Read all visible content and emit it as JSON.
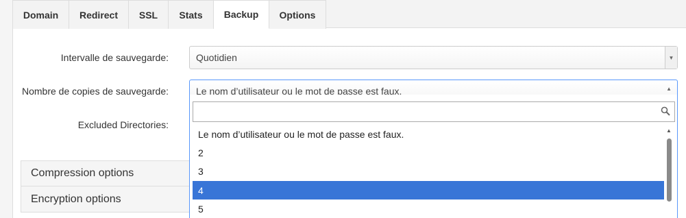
{
  "tabs": [
    {
      "label": "Domain"
    },
    {
      "label": "Redirect"
    },
    {
      "label": "SSL"
    },
    {
      "label": "Stats"
    },
    {
      "label": "Backup",
      "active": true
    },
    {
      "label": "Options"
    }
  ],
  "form": {
    "interval_label": "Intervalle de sauvegarde:",
    "interval_value": "Quotidien",
    "copies_label": "Nombre de copies de sauvegarde:",
    "copies_value": "Le nom d’utilisateur ou le mot de passe est faux.",
    "excluded_label": "Excluded Directories:"
  },
  "accordions": {
    "compression": "Compression options",
    "encryption": "Encryption options"
  },
  "dropdown": {
    "search_value": "",
    "options": [
      "Le nom d’utilisateur ou le mot de passe est faux.",
      "2",
      "3",
      "4",
      "5"
    ],
    "highlighted": "4"
  },
  "icons": {
    "search": "search-icon",
    "arrow_down": "arrow-down-icon",
    "arrow_up": "arrow-up-icon"
  },
  "colors": {
    "highlight": "#3875d7",
    "focus_border": "#5897fb"
  }
}
